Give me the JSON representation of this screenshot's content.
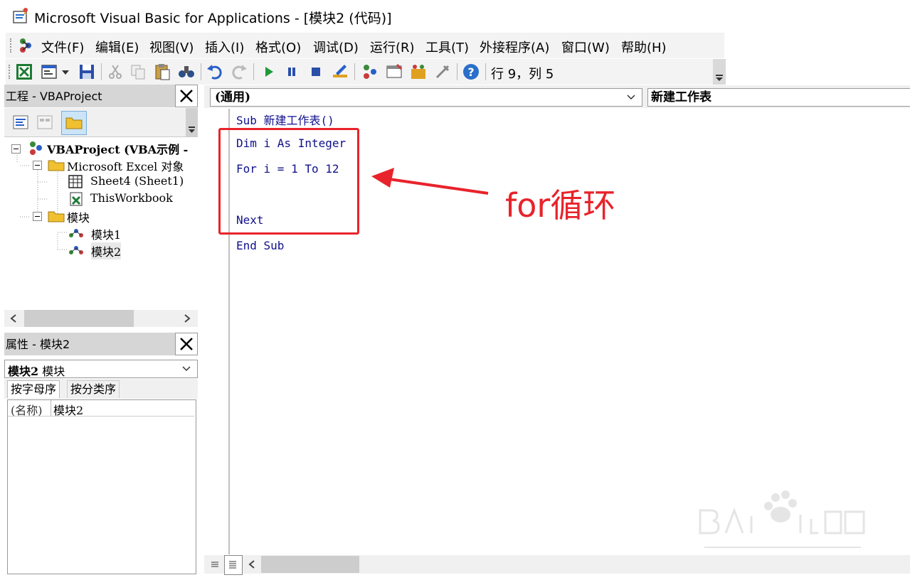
{
  "window": {
    "title": "Microsoft Visual Basic for Applications - [模块2 (代码)]"
  },
  "menubar": {
    "items": [
      "文件(F)",
      "编辑(E)",
      "视图(V)",
      "插入(I)",
      "格式(O)",
      "调试(D)",
      "运行(R)",
      "工具(T)",
      "外接程序(A)",
      "窗口(W)",
      "帮助(H)"
    ]
  },
  "toolbar": {
    "status": "行 9，列 5"
  },
  "project": {
    "title": "工程 - VBAProject",
    "tree": [
      {
        "label": "VBAProject (VBA示例 -",
        "level": 0,
        "icon": "vba-project-icon",
        "bold": true
      },
      {
        "label": "Microsoft Excel 对象",
        "level": 1,
        "icon": "folder-icon"
      },
      {
        "label": "Sheet4 (Sheet1)",
        "level": 2,
        "icon": "sheet-icon"
      },
      {
        "label": "ThisWorkbook",
        "level": 2,
        "icon": "workbook-icon"
      },
      {
        "label": "模块",
        "level": 1,
        "icon": "folder-icon"
      },
      {
        "label": "模块1",
        "level": 2,
        "icon": "module-icon"
      },
      {
        "label": "模块2",
        "level": 2,
        "icon": "module-icon"
      }
    ]
  },
  "properties": {
    "title": "属性 - 模块2",
    "selected_object": "模块2 模块",
    "selected_object_name": "模块2",
    "selected_object_type": " 模块",
    "tabs": [
      "按字母序",
      "按分类序"
    ],
    "rows": [
      {
        "name": "(名称)",
        "value": "模块2"
      }
    ]
  },
  "code": {
    "object_combo": "(通用)",
    "proc_combo": "新建工作表",
    "lines": [
      "Sub 新建工作表()",
      "Dim i As Integer",
      "For i = 1 To 12",
      "",
      "Next",
      "End Sub"
    ]
  },
  "annotation": {
    "text": "for循环",
    "color": "#e8232b"
  },
  "colors": {
    "code_text": "#10108c",
    "panel_header": "#d6d6d6"
  }
}
